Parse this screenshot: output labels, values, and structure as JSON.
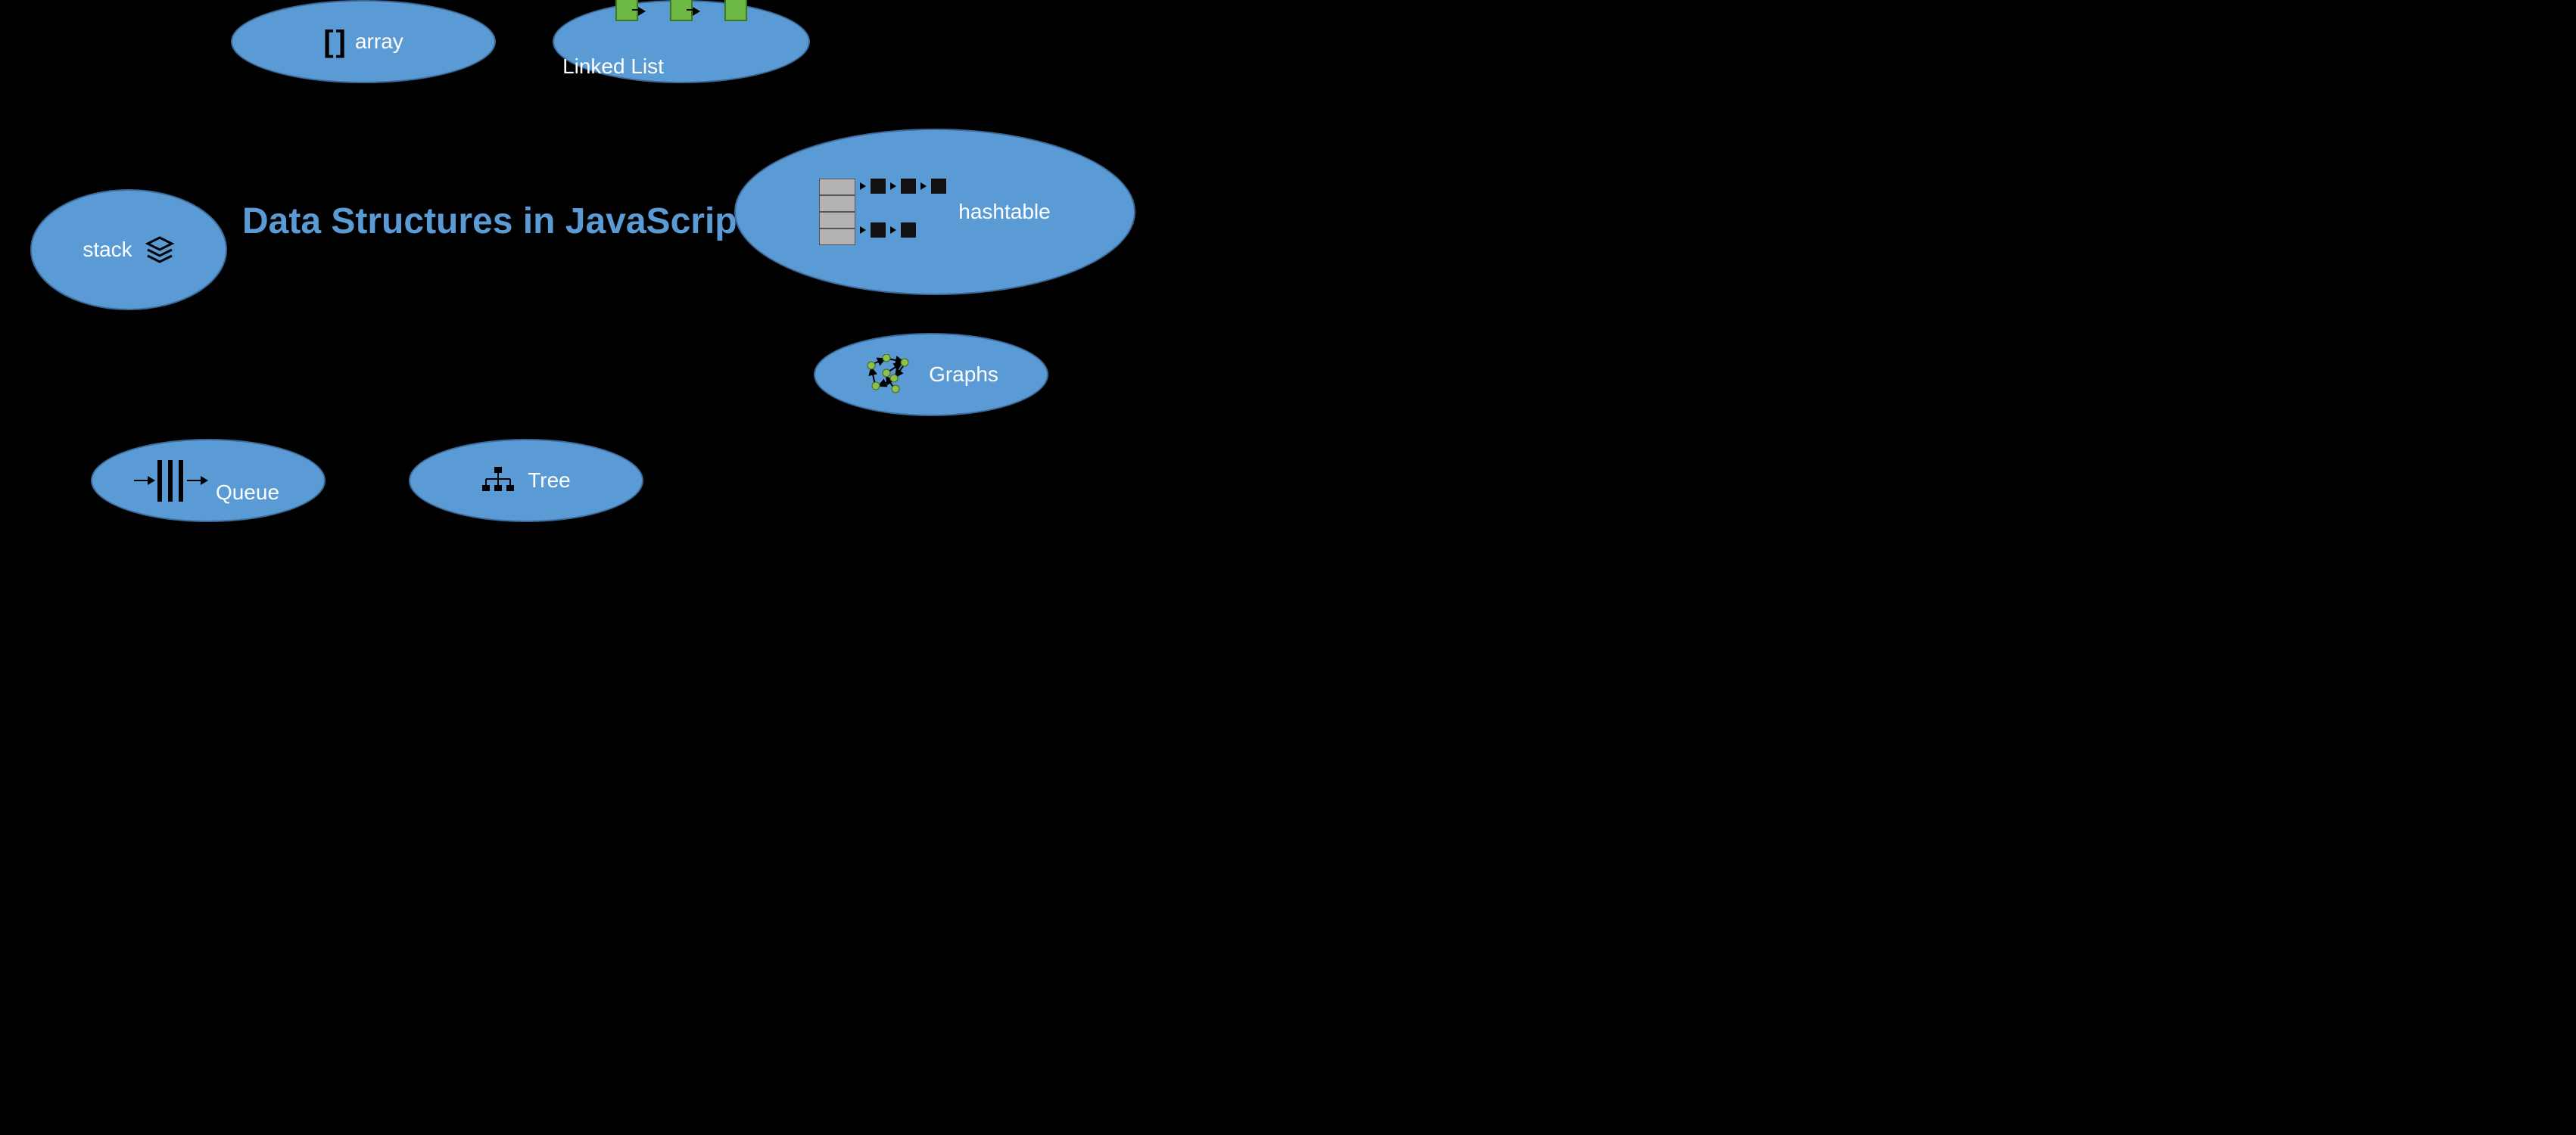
{
  "title": "Data Structures in JavaScript",
  "nodes": {
    "array": {
      "label": "array"
    },
    "linked": {
      "label": "Linked List"
    },
    "stack": {
      "label": "stack"
    },
    "hashtable": {
      "label": "hashtable"
    },
    "graphs": {
      "label": "Graphs"
    },
    "queue": {
      "label": "Queue"
    },
    "tree": {
      "label": "Tree"
    }
  },
  "colors": {
    "ellipse_fill": "#5b9bd5",
    "ellipse_stroke": "#3d6a99",
    "title": "#5b9bd5",
    "linked_box": "#6cba44",
    "background": "#000000"
  }
}
